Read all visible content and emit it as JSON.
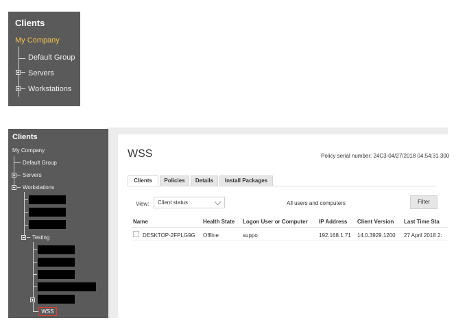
{
  "tree_small": {
    "title": "Clients",
    "root": "My Company",
    "items": [
      "Default Group",
      "Servers",
      "Workstations"
    ]
  },
  "tree_full": {
    "title": "Clients",
    "root": "My Company",
    "items": {
      "default_group": "Default Group",
      "servers": "Servers",
      "workstations": "Workstations",
      "testing": "Testing",
      "wss": "WSS"
    }
  },
  "main": {
    "title": "WSS",
    "policy_serial": "Policy serial number: 24C3-04/27/2018 04:54:31 300",
    "tabs": [
      "Clients",
      "Policies",
      "Details",
      "Install Packages"
    ],
    "active_tab": "Clients",
    "view_label": "View:",
    "view_value": "Client status",
    "scope_text": "All users and computers",
    "filter_label": "Filter",
    "columns": [
      "Name",
      "Health State",
      "Logon User or Computer",
      "IP Address",
      "Client Version",
      "Last Time Sta"
    ],
    "rows": [
      [
        "DESKTOP-2FPLG9G",
        "Offline",
        "suppo",
        "192.168.1.71",
        "14.0.3929.1200",
        "27 April 2018 2:"
      ]
    ]
  },
  "colors": {
    "tree_bg": "#5a5a5a",
    "root_highlight": "#f2c14e",
    "selection_border": "#e23b3b"
  }
}
